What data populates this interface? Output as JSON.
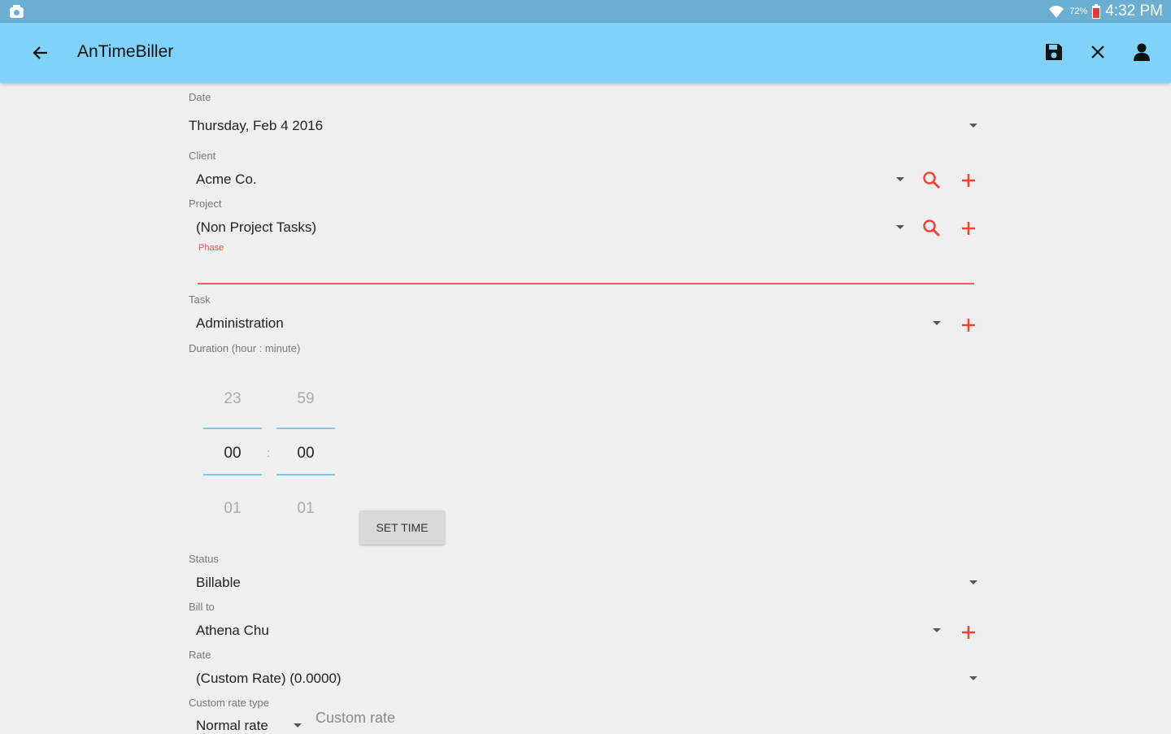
{
  "status_bar": {
    "battery": "72%",
    "time": "4:32 PM"
  },
  "app_bar": {
    "title": "AnTimeBiller",
    "icons": [
      "back-arrow-icon",
      "save-icon",
      "close-icon",
      "person-icon"
    ]
  },
  "accent_color": "#f44336",
  "form": {
    "date": {
      "label": "Date",
      "value": "Thursday, Feb 4 2016"
    },
    "client": {
      "label": "Client",
      "value": "Acme Co."
    },
    "project": {
      "label": "Project",
      "value": "(Non Project Tasks)",
      "phase_label": "Phase"
    },
    "task": {
      "label": "Task",
      "value": "Administration"
    },
    "duration": {
      "label": "Duration (hour : minute)",
      "hours_prev": "23",
      "hours": "00",
      "hours_next": "01",
      "minutes_prev": "59",
      "minutes": "00",
      "minutes_next": "01",
      "separator": ":",
      "set_time_label": "SET TIME"
    },
    "status": {
      "label": "Status",
      "value": "Billable"
    },
    "bill_to": {
      "label": "Bill to",
      "value": "Athena Chu"
    },
    "rate": {
      "label": "Rate",
      "value": "(Custom Rate) (0.0000)"
    },
    "custom_rate_type": {
      "label": "Custom rate type",
      "value": "Normal rate"
    },
    "custom_rate": {
      "placeholder": "Custom rate"
    }
  }
}
